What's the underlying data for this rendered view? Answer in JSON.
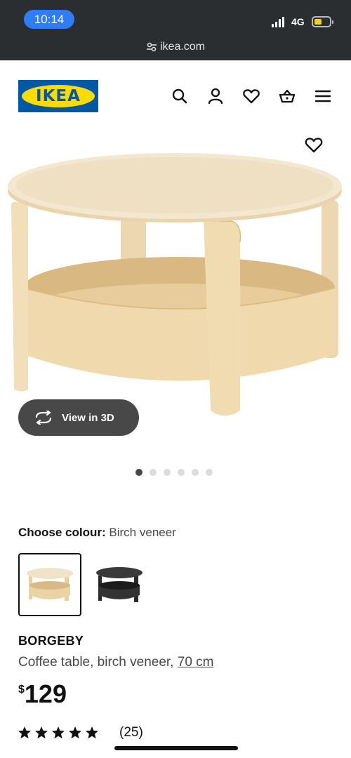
{
  "status_bar": {
    "time": "10:14",
    "network": "4G"
  },
  "browser": {
    "url": "ikea.com"
  },
  "header": {
    "logo_text": "IKEA",
    "icons": [
      "search-icon",
      "account-icon",
      "favourites-icon",
      "basket-icon",
      "menu-icon"
    ]
  },
  "gallery": {
    "view_3d_label": "View in 3D",
    "slide_count": 6,
    "active_slide": 1
  },
  "colour": {
    "label": "Choose colour:",
    "value": "Birch veneer",
    "options": [
      "Birch veneer",
      "Black"
    ]
  },
  "product": {
    "name": "BORGEBY",
    "description": "Coffee table, birch veneer,",
    "size": "70 cm",
    "currency": "$",
    "price": "129"
  },
  "rating": {
    "stars": 5,
    "count": "(25)"
  },
  "colors": {
    "ikea_blue": "#0058a3",
    "ikea_yellow": "#ffdb00",
    "pill_blue": "#2f7cf6"
  }
}
